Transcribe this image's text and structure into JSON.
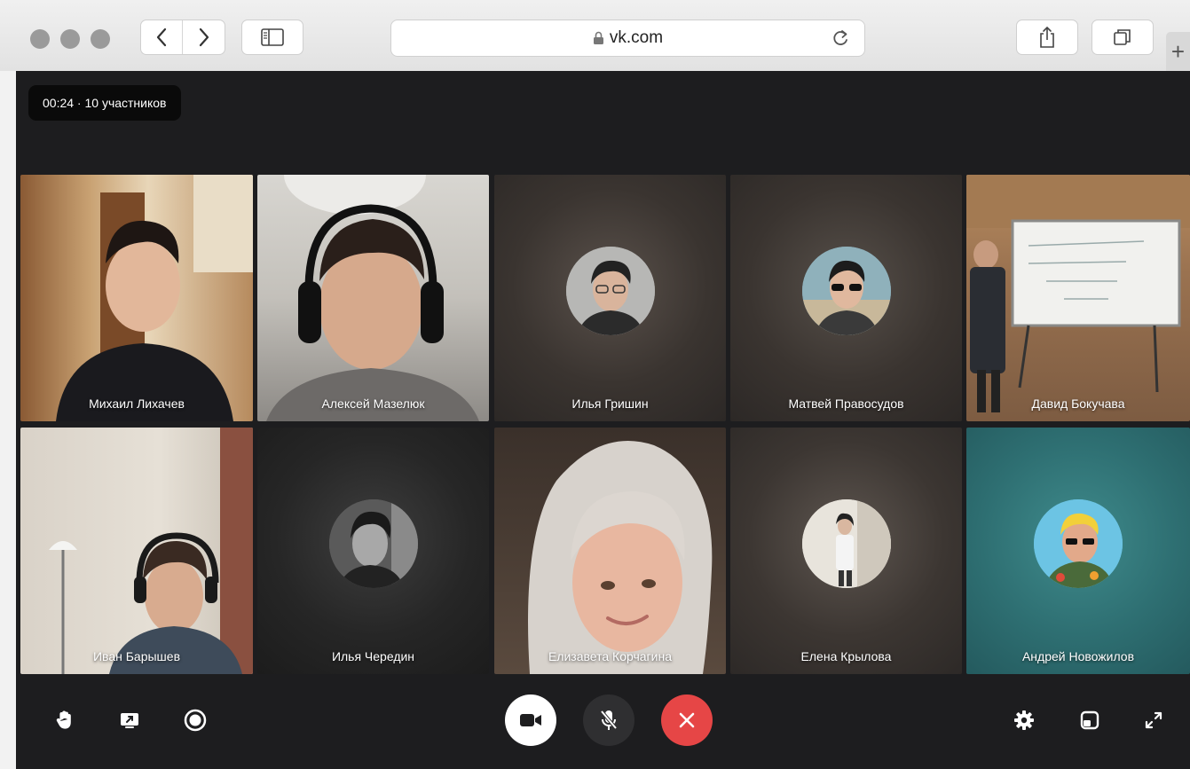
{
  "browser": {
    "address": "vk.com",
    "newtab_glyph": "+"
  },
  "call": {
    "status": "00:24 · 10 участников",
    "participants": [
      {
        "name": "Михаил Лихачев",
        "mode": "video"
      },
      {
        "name": "Алексей Мазелюк",
        "mode": "video"
      },
      {
        "name": "Илья Гришин",
        "mode": "avatar"
      },
      {
        "name": "Матвей Правосудов",
        "mode": "avatar"
      },
      {
        "name": "Давид Бокучава",
        "mode": "video"
      },
      {
        "name": "Иван Барышев",
        "mode": "video"
      },
      {
        "name": "Илья Чередин",
        "mode": "avatar"
      },
      {
        "name": "Елизавета Корчагина",
        "mode": "video"
      },
      {
        "name": "Елена Крылова",
        "mode": "avatar"
      },
      {
        "name": "Андрей Новожилов",
        "mode": "avatar"
      }
    ]
  },
  "controls": {
    "left": [
      "raise-hand-icon",
      "screen-share-icon",
      "record-icon"
    ],
    "center": [
      "camera-icon",
      "mic-off-icon",
      "end-call-icon"
    ],
    "right": [
      "settings-gear-icon",
      "layout-icon",
      "fullscreen-icon"
    ],
    "end_call_color": "#e64646",
    "camera_bg": "#ffffff",
    "mic_bg": "#2f2f31"
  },
  "colors": {
    "call_bg": "#1d1d1f",
    "status_bg": "#0a0a0a"
  }
}
